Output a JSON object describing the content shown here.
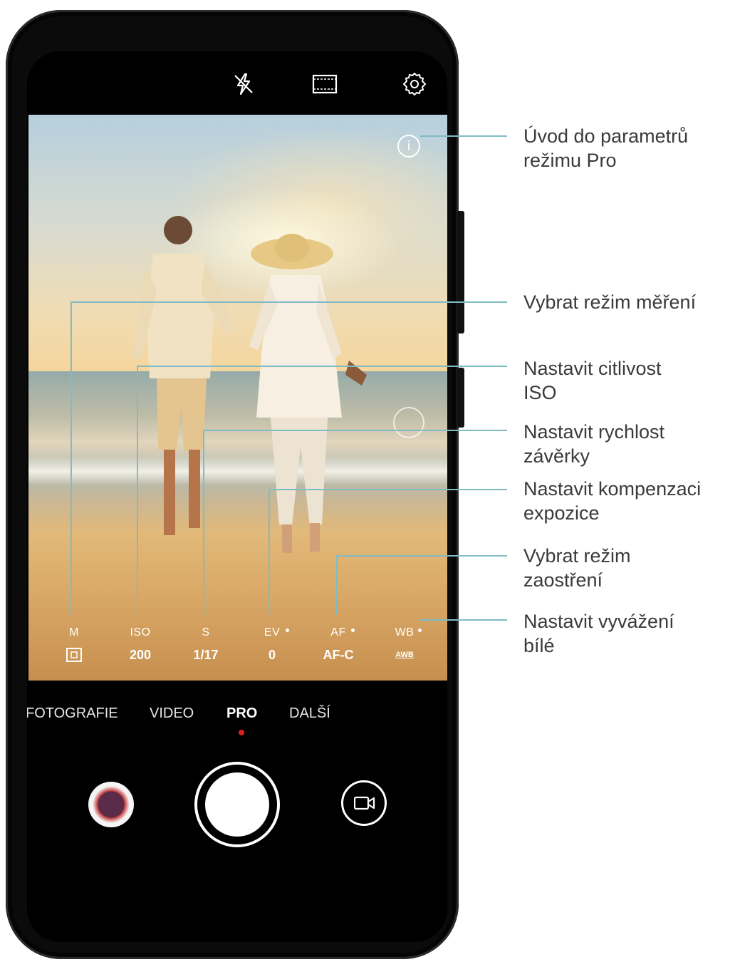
{
  "top_icons": [
    "flash-off-icon",
    "aspect-ratio-icon",
    "settings-gear-icon"
  ],
  "params": [
    {
      "label": "M",
      "value_icon": "metering-icon"
    },
    {
      "label": "ISO",
      "value": "200"
    },
    {
      "label": "S",
      "value": "1/17"
    },
    {
      "label": "EV",
      "value": "0"
    },
    {
      "label": "AF",
      "value": "AF-C"
    },
    {
      "label": "WB",
      "value": "AWB"
    }
  ],
  "modes": [
    {
      "label": "FOTOGRAFIE"
    },
    {
      "label": "VIDEO"
    },
    {
      "label": "PRO"
    },
    {
      "label": "DALŠÍ"
    }
  ],
  "active_mode": "PRO",
  "callouts": {
    "info": "Úvod do parametrů\nrežimu Pro",
    "metering": "Vybrat režim měření",
    "iso": "Nastavit citlivost\nISO",
    "shutter": "Nastavit rychlost\nzávěrky",
    "ev": "Nastavit kompenzaci\nexpozice",
    "af": "Vybrat režim\nzaostření",
    "wb": "Nastavit vyvážení\nbílé"
  },
  "colors": {
    "callout_line": "#7fbcc5",
    "active_dot": "#e0201c"
  }
}
